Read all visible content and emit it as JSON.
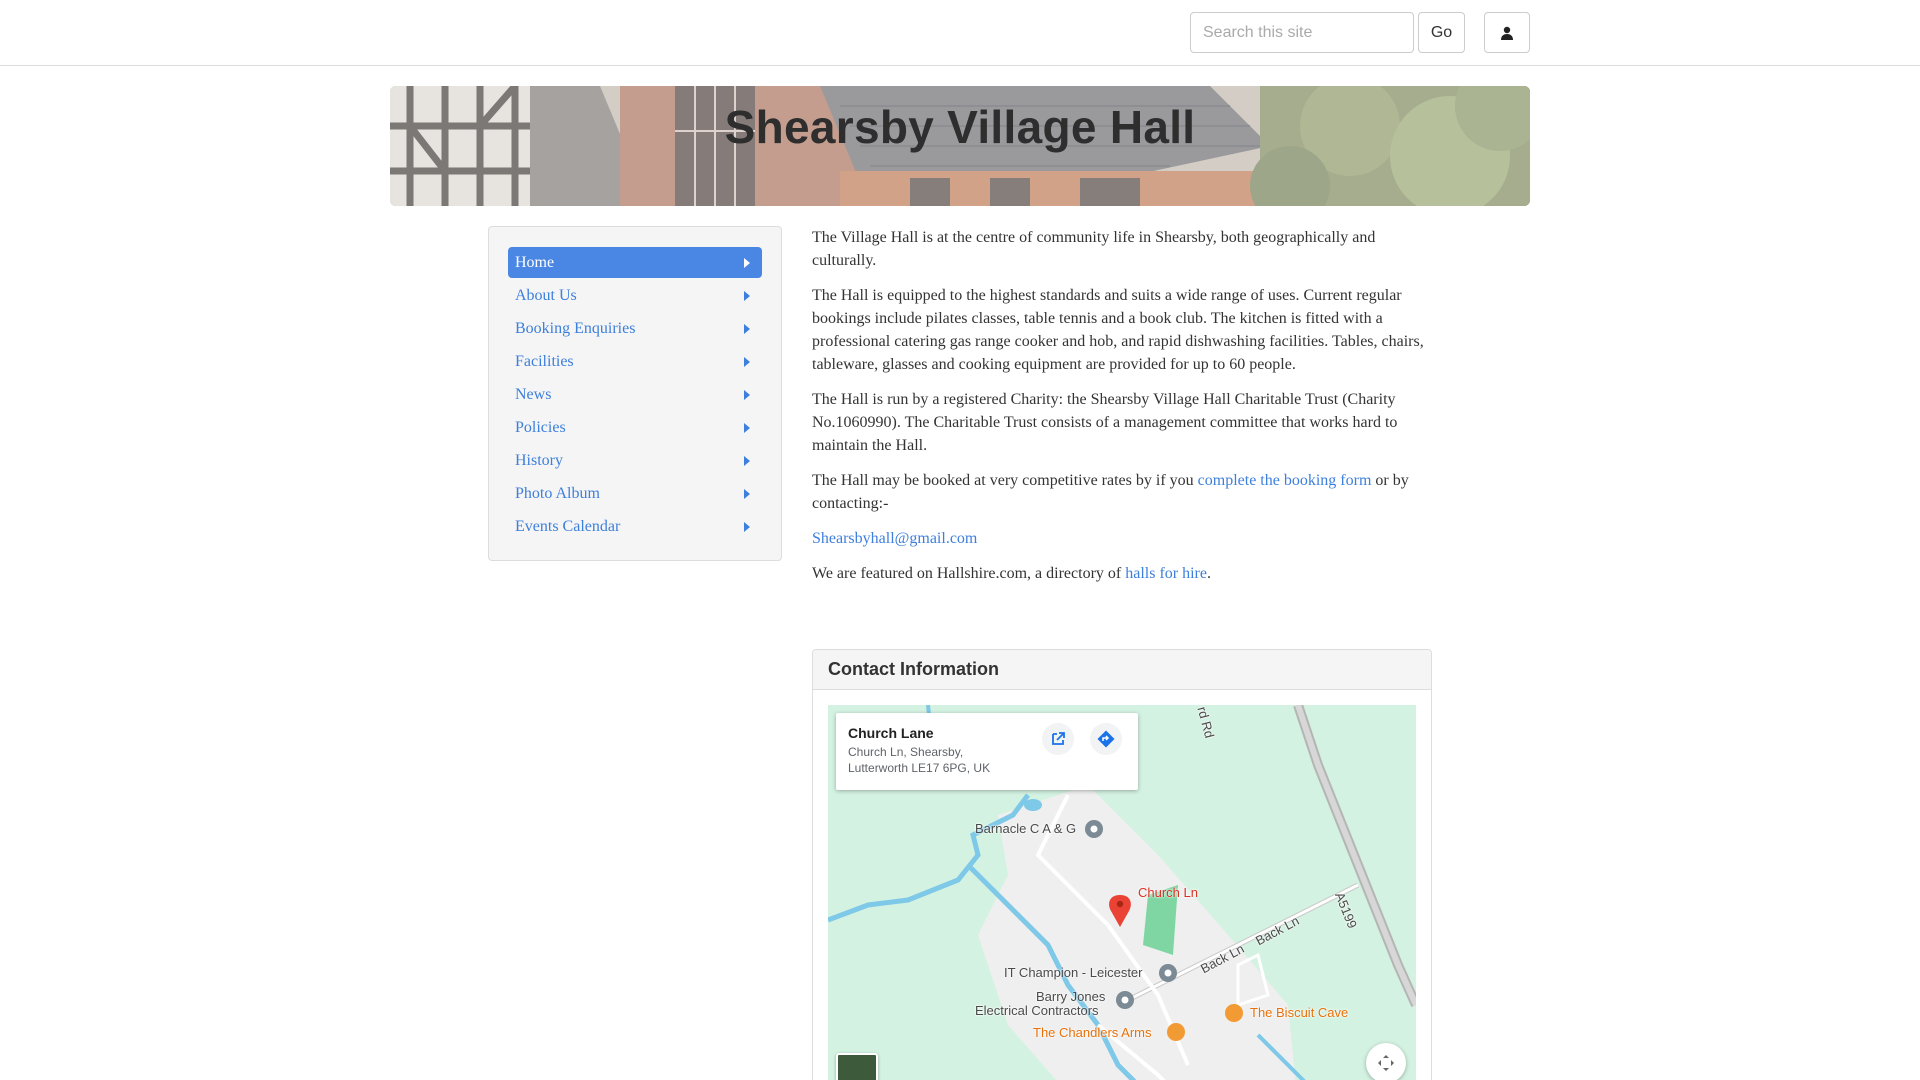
{
  "topbar": {
    "search_placeholder": "Search this site",
    "go_label": "Go",
    "user_icon": "user-icon"
  },
  "banner": {
    "title": "Shearsby Village Hall"
  },
  "sidebar": {
    "items": [
      {
        "label": "Home",
        "active": true
      },
      {
        "label": "About Us"
      },
      {
        "label": "Booking Enquiries"
      },
      {
        "label": "Facilities"
      },
      {
        "label": "News"
      },
      {
        "label": "Policies"
      },
      {
        "label": "History"
      },
      {
        "label": "Photo Album"
      },
      {
        "label": "Events Calendar"
      }
    ]
  },
  "main": {
    "p1": "The Village Hall is at the centre of community life in Shearsby, both geographically and culturally.",
    "p2": "The Hall is equipped to the highest standards and suits a wide range of uses. Current regular bookings include pilates classes, table tennis and a book club. The kitchen is fitted with a professional catering gas range cooker and hob, and rapid dishwashing facilities. Tables, chairs, tableware, glasses and cooking equipment are provided for up to 60 people.",
    "p3": "The Hall is run by a registered Charity: the Shearsby Village Hall Charitable Trust (Charity No.1060990). The Charitable Trust consists of a management committee that works hard to maintain the Hall.",
    "p4_before": "The Hall may be booked at very competitive rates by if you ",
    "p4_link": "complete the booking form",
    "p4_after": " or by contacting:-",
    "email": "Shearsbyhall@gmail.com",
    "p6_before": "We are featured on Hallshire.com, a directory of ",
    "p6_link": "halls for hire",
    "p6_after": "."
  },
  "contact": {
    "heading": "Contact Information",
    "map": {
      "place_name": "Church Lane",
      "address": "Church Ln, Shearsby, Lutterworth LE17 6PG, UK",
      "labels": {
        "rd": "rd Rd",
        "barnacle": "Barnacle C A & G",
        "church_ln": "Church Ln",
        "a5199": "A5199",
        "back_ln_1": "Back Ln",
        "back_ln_2": "Back Ln",
        "it_champion": "IT Champion - Leicester",
        "barry_jones_1": "Barry Jones",
        "barry_jones_2": "Electrical Contractors",
        "biscuit_cave": "The Biscuit Cave",
        "chandlers": "The Chandlers Arms"
      }
    }
  },
  "colors": {
    "link": "#3d7fdc",
    "nav_active": "#4a86e3",
    "map_pin": "#ea4335"
  }
}
